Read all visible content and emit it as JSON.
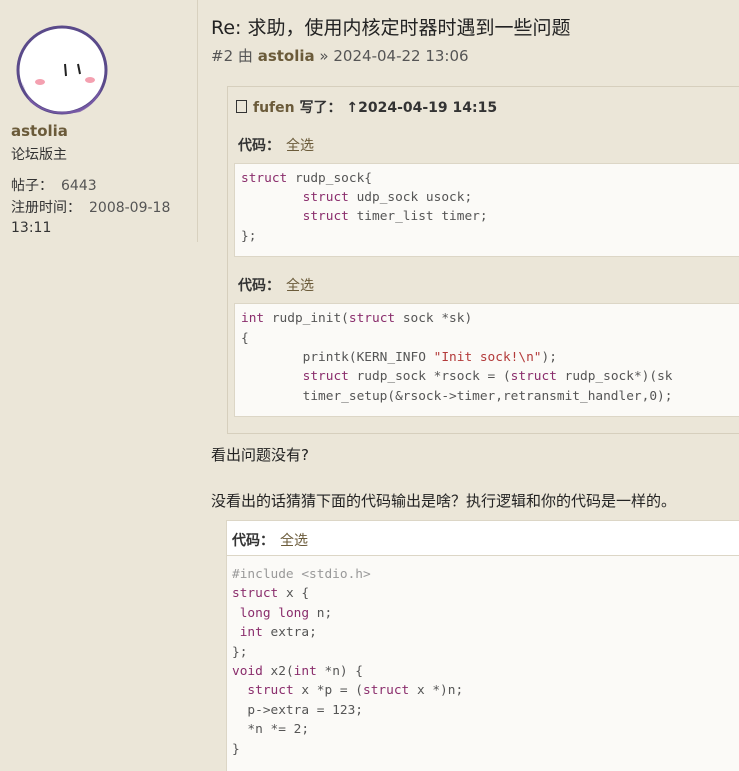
{
  "user": {
    "name": "astolia",
    "rank": "论坛版主",
    "posts_label": "帖子：",
    "posts_value": "6443",
    "reg_label": "注册时间：",
    "reg_date": "2008-09-18",
    "reg_time": "13:11"
  },
  "post": {
    "title": "Re: 求助，使用内核定时器时遇到一些问题",
    "number": "#2",
    "by": "由",
    "author": "astolia",
    "sep": "»",
    "datetime": "2024-04-22 13:06"
  },
  "quote": {
    "author": "fufen",
    "wrote": "写了：",
    "arrow": "↑",
    "datetime": "2024-04-19 14:15"
  },
  "code_label": "代码：",
  "select_all": "全选",
  "code1": [
    "struct rudp_sock{",
    "        struct udp_sock usock;",
    "        struct timer_list timer;",
    "};"
  ],
  "code2": [
    "int rudp_init(struct sock *sk)",
    "{",
    "        printk(KERN_INFO \"Init sock!\\n\");",
    "        struct rudp_sock *rsock = (struct rudp_sock*)(sk",
    "        timer_setup(&rsock->timer,retransmit_handler,0);"
  ],
  "text1": "看出问题没有?",
  "text2": "没看出的话猜猜下面的代码输出是啥？执行逻辑和你的代码是一样的。",
  "code3": [
    "#include <stdio.h>",
    "struct x {",
    " long long n;",
    " int extra;",
    "};",
    "void x2(int *n) {",
    "  struct x *p = (struct x *)n;",
    "  p->extra = 123;",
    "  *n *= 2;",
    "}"
  ],
  "colors": {
    "background": "#ebe6d8",
    "author": "#6b5b3a",
    "keyword": "#8a2d6c",
    "string": "#b33a3a"
  },
  "icons": [
    "avatar-ghost",
    "quote-square-icon"
  ]
}
